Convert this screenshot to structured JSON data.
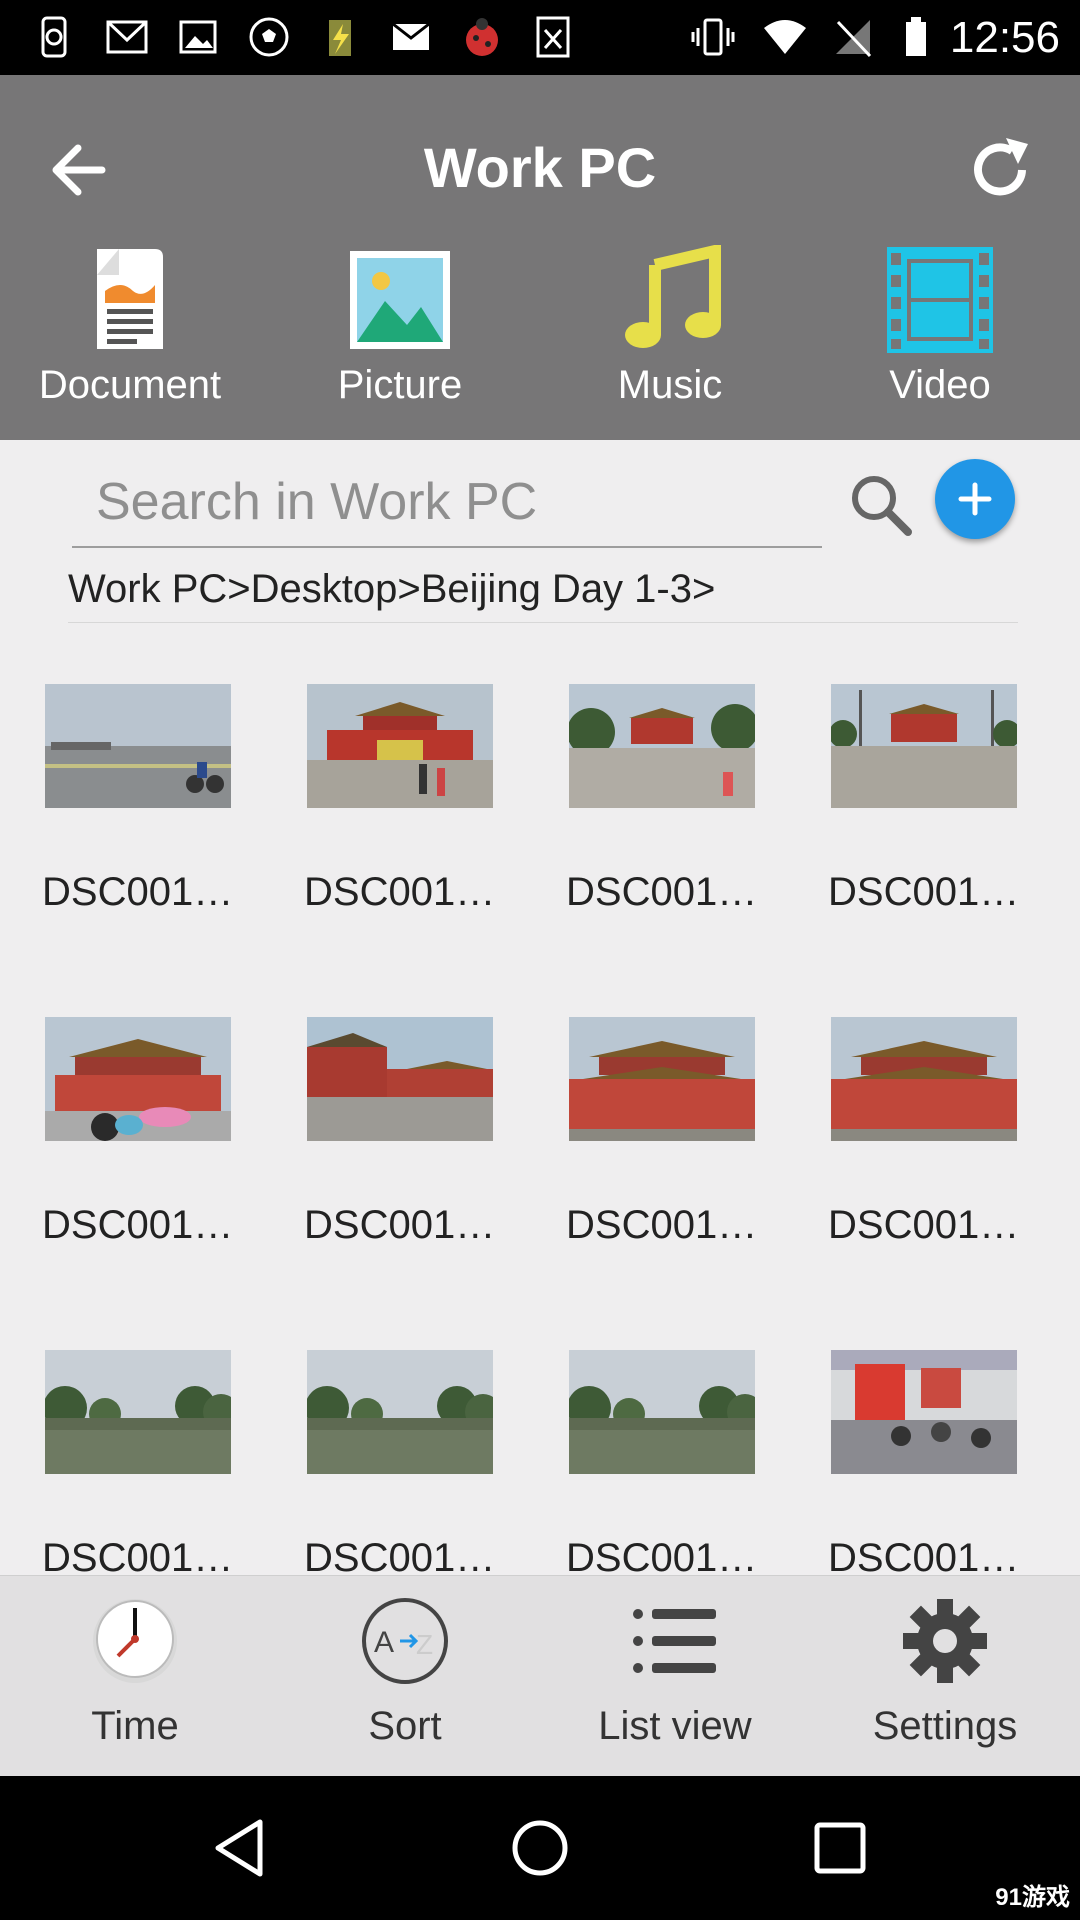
{
  "status_bar": {
    "time": "12:56",
    "icons": [
      "sync-phone-icon",
      "gmail-icon",
      "image-icon",
      "soccer-ball-icon",
      "battery-app-icon",
      "mail-icon",
      "ladybug-icon",
      "excel-icon",
      "vibrate-icon",
      "wifi-icon",
      "no-signal-icon",
      "battery-icon"
    ]
  },
  "header": {
    "title": "Work PC",
    "back_icon": "arrow-left-icon",
    "refresh_icon": "refresh-icon"
  },
  "categories": [
    {
      "label": "Document",
      "icon": "document-icon"
    },
    {
      "label": "Picture",
      "icon": "picture-icon"
    },
    {
      "label": "Music",
      "icon": "music-note-icon",
      "color": "#e7df4a"
    },
    {
      "label": "Video",
      "icon": "film-icon",
      "color": "#1fc4e6"
    }
  ],
  "search": {
    "placeholder": "Search in Work PC",
    "add_button_color": "#2196e6"
  },
  "breadcrumb": "Work PC>Desktop>Beijing Day 1-3>",
  "files": [
    {
      "name": "DSC001…",
      "scene": "square"
    },
    {
      "name": "DSC001…",
      "scene": "gate"
    },
    {
      "name": "DSC001…",
      "scene": "gate-trees"
    },
    {
      "name": "DSC001…",
      "scene": "gate-lamps"
    },
    {
      "name": "DSC001…",
      "scene": "palace-crowd"
    },
    {
      "name": "DSC001…",
      "scene": "palace-wall"
    },
    {
      "name": "DSC001…",
      "scene": "palace"
    },
    {
      "name": "DSC001…",
      "scene": "palace"
    },
    {
      "name": "DSC001…",
      "scene": "moat"
    },
    {
      "name": "DSC001…",
      "scene": "moat"
    },
    {
      "name": "DSC001…",
      "scene": "moat"
    },
    {
      "name": "DSC001…",
      "scene": "subway"
    }
  ],
  "bottom_bar": [
    {
      "label": "Time",
      "icon": "clock-icon"
    },
    {
      "label": "Sort",
      "icon": "sort-az-icon"
    },
    {
      "label": "List view",
      "icon": "list-icon"
    },
    {
      "label": "Settings",
      "icon": "gear-icon"
    }
  ],
  "nav_bar": [
    "back-triangle-icon",
    "home-circle-icon",
    "recents-square-icon"
  ],
  "watermark": "91游戏"
}
